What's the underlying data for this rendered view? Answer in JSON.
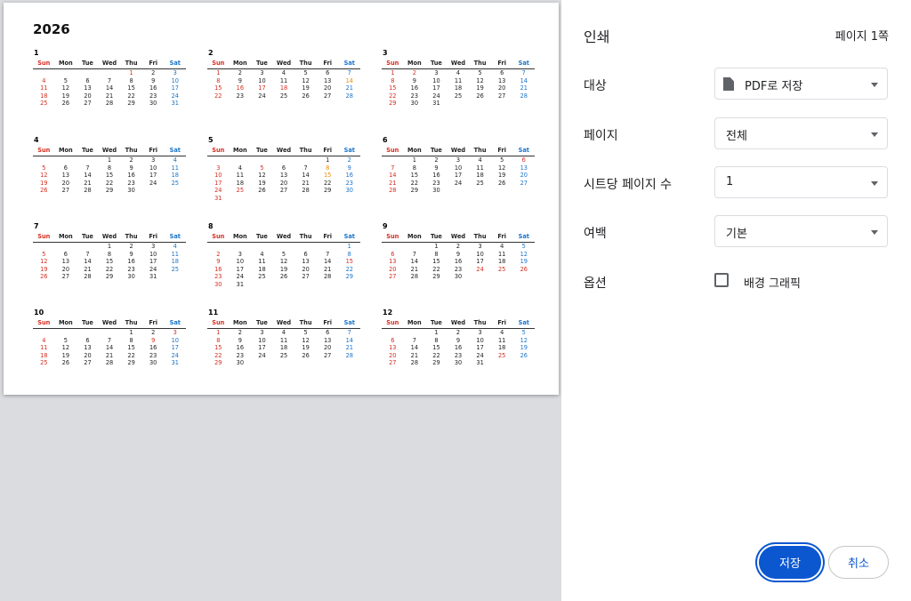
{
  "calendar": {
    "year": "2026",
    "weekdays": [
      "Sun",
      "Mon",
      "Tue",
      "Wed",
      "Thu",
      "Fri",
      "Sat"
    ],
    "months": [
      {
        "name": "1",
        "rows": [
          [
            "",
            "",
            "",
            "",
            "1",
            "2",
            "3"
          ],
          [
            "4",
            "5",
            "6",
            "7",
            "8",
            "9",
            "10"
          ],
          [
            "11",
            "12",
            "13",
            "14",
            "15",
            "16",
            "17"
          ],
          [
            "18",
            "19",
            "20",
            "21",
            "22",
            "23",
            "24"
          ],
          [
            "25",
            "26",
            "27",
            "28",
            "29",
            "30",
            "31"
          ]
        ],
        "red": [
          "1"
        ],
        "orange": []
      },
      {
        "name": "2",
        "rows": [
          [
            "1",
            "2",
            "3",
            "4",
            "5",
            "6",
            "7"
          ],
          [
            "8",
            "9",
            "10",
            "11",
            "12",
            "13",
            "14"
          ],
          [
            "15",
            "16",
            "17",
            "18",
            "19",
            "20",
            "21"
          ],
          [
            "22",
            "23",
            "24",
            "25",
            "26",
            "27",
            "28"
          ]
        ],
        "red": [
          "16",
          "17",
          "18"
        ],
        "orange": [
          "14"
        ]
      },
      {
        "name": "3",
        "rows": [
          [
            "1",
            "2",
            "3",
            "4",
            "5",
            "6",
            "7"
          ],
          [
            "8",
            "9",
            "10",
            "11",
            "12",
            "13",
            "14"
          ],
          [
            "15",
            "16",
            "17",
            "18",
            "19",
            "20",
            "21"
          ],
          [
            "22",
            "23",
            "24",
            "25",
            "26",
            "27",
            "28"
          ],
          [
            "29",
            "30",
            "31",
            "",
            "",
            "",
            ""
          ]
        ],
        "red": [
          "2"
        ],
        "orange": []
      },
      {
        "name": "4",
        "rows": [
          [
            "",
            "",
            "",
            "1",
            "2",
            "3",
            "4"
          ],
          [
            "5",
            "6",
            "7",
            "8",
            "9",
            "10",
            "11"
          ],
          [
            "12",
            "13",
            "14",
            "15",
            "16",
            "17",
            "18"
          ],
          [
            "19",
            "20",
            "21",
            "22",
            "23",
            "24",
            "25"
          ],
          [
            "26",
            "27",
            "28",
            "29",
            "30",
            "",
            ""
          ]
        ],
        "red": [],
        "orange": []
      },
      {
        "name": "5",
        "rows": [
          [
            "",
            "",
            "",
            "",
            "",
            "1",
            "2"
          ],
          [
            "3",
            "4",
            "5",
            "6",
            "7",
            "8",
            "9"
          ],
          [
            "10",
            "11",
            "12",
            "13",
            "14",
            "15",
            "16"
          ],
          [
            "17",
            "18",
            "19",
            "20",
            "21",
            "22",
            "23"
          ],
          [
            "24",
            "25",
            "26",
            "27",
            "28",
            "29",
            "30"
          ],
          [
            "31",
            "",
            "",
            "",
            "",
            "",
            ""
          ]
        ],
        "red": [
          "5",
          "25"
        ],
        "orange": [
          "8",
          "15"
        ]
      },
      {
        "name": "6",
        "rows": [
          [
            "",
            "1",
            "2",
            "3",
            "4",
            "5",
            "6"
          ],
          [
            "7",
            "8",
            "9",
            "10",
            "11",
            "12",
            "13"
          ],
          [
            "14",
            "15",
            "16",
            "17",
            "18",
            "19",
            "20"
          ],
          [
            "21",
            "22",
            "23",
            "24",
            "25",
            "26",
            "27"
          ],
          [
            "28",
            "29",
            "30",
            "",
            "",
            "",
            ""
          ]
        ],
        "red": [
          "6"
        ],
        "orange": []
      },
      {
        "name": "7",
        "rows": [
          [
            "",
            "",
            "",
            "1",
            "2",
            "3",
            "4"
          ],
          [
            "5",
            "6",
            "7",
            "8",
            "9",
            "10",
            "11"
          ],
          [
            "12",
            "13",
            "14",
            "15",
            "16",
            "17",
            "18"
          ],
          [
            "19",
            "20",
            "21",
            "22",
            "23",
            "24",
            "25"
          ],
          [
            "26",
            "27",
            "28",
            "29",
            "30",
            "31",
            ""
          ]
        ],
        "red": [],
        "orange": []
      },
      {
        "name": "8",
        "rows": [
          [
            "",
            "",
            "",
            "",
            "",
            "",
            "1"
          ],
          [
            "2",
            "3",
            "4",
            "5",
            "6",
            "7",
            "8"
          ],
          [
            "9",
            "10",
            "11",
            "12",
            "13",
            "14",
            "15"
          ],
          [
            "16",
            "17",
            "18",
            "19",
            "20",
            "21",
            "22"
          ],
          [
            "23",
            "24",
            "25",
            "26",
            "27",
            "28",
            "29"
          ],
          [
            "30",
            "31",
            "",
            "",
            "",
            "",
            ""
          ]
        ],
        "red": [
          "15"
        ],
        "orange": []
      },
      {
        "name": "9",
        "rows": [
          [
            "",
            "",
            "1",
            "2",
            "3",
            "4",
            "5"
          ],
          [
            "6",
            "7",
            "8",
            "9",
            "10",
            "11",
            "12"
          ],
          [
            "13",
            "14",
            "15",
            "16",
            "17",
            "18",
            "19"
          ],
          [
            "20",
            "21",
            "22",
            "23",
            "24",
            "25",
            "26"
          ],
          [
            "27",
            "28",
            "29",
            "30",
            "",
            "",
            ""
          ]
        ],
        "red": [
          "24",
          "25",
          "26"
        ],
        "orange": []
      },
      {
        "name": "10",
        "rows": [
          [
            "",
            "",
            "",
            "",
            "1",
            "2",
            "3"
          ],
          [
            "4",
            "5",
            "6",
            "7",
            "8",
            "9",
            "10"
          ],
          [
            "11",
            "12",
            "13",
            "14",
            "15",
            "16",
            "17"
          ],
          [
            "18",
            "19",
            "20",
            "21",
            "22",
            "23",
            "24"
          ],
          [
            "25",
            "26",
            "27",
            "28",
            "29",
            "30",
            "31"
          ]
        ],
        "red": [
          "3",
          "9"
        ],
        "orange": []
      },
      {
        "name": "11",
        "rows": [
          [
            "1",
            "2",
            "3",
            "4",
            "5",
            "6",
            "7"
          ],
          [
            "8",
            "9",
            "10",
            "11",
            "12",
            "13",
            "14"
          ],
          [
            "15",
            "16",
            "17",
            "18",
            "19",
            "20",
            "21"
          ],
          [
            "22",
            "23",
            "24",
            "25",
            "26",
            "27",
            "28"
          ],
          [
            "29",
            "30",
            "",
            "",
            "",
            "",
            ""
          ]
        ],
        "red": [],
        "orange": []
      },
      {
        "name": "12",
        "rows": [
          [
            "",
            "",
            "1",
            "2",
            "3",
            "4",
            "5"
          ],
          [
            "6",
            "7",
            "8",
            "9",
            "10",
            "11",
            "12"
          ],
          [
            "13",
            "14",
            "15",
            "16",
            "17",
            "18",
            "19"
          ],
          [
            "20",
            "21",
            "22",
            "23",
            "24",
            "25",
            "26"
          ],
          [
            "27",
            "28",
            "29",
            "30",
            "31",
            "",
            ""
          ]
        ],
        "red": [
          "25"
        ],
        "orange": []
      }
    ]
  },
  "panel": {
    "title": "인쇄",
    "page_count": "페이지 1쪽",
    "destination_label": "대상",
    "destination_value": "PDF로 저장",
    "pages_label": "페이지",
    "pages_value": "전체",
    "per_sheet_label": "시트당 페이지 수",
    "per_sheet_value": "1",
    "margins_label": "여백",
    "margins_value": "기본",
    "options_label": "옵션",
    "background_graphics_label": "배경 그래픽",
    "save_label": "저장",
    "cancel_label": "취소"
  },
  "colors": {
    "primary": "#0b57d0",
    "holiday": "#d62d20",
    "saturday": "#1a73c8",
    "special": "#ee8b00"
  }
}
